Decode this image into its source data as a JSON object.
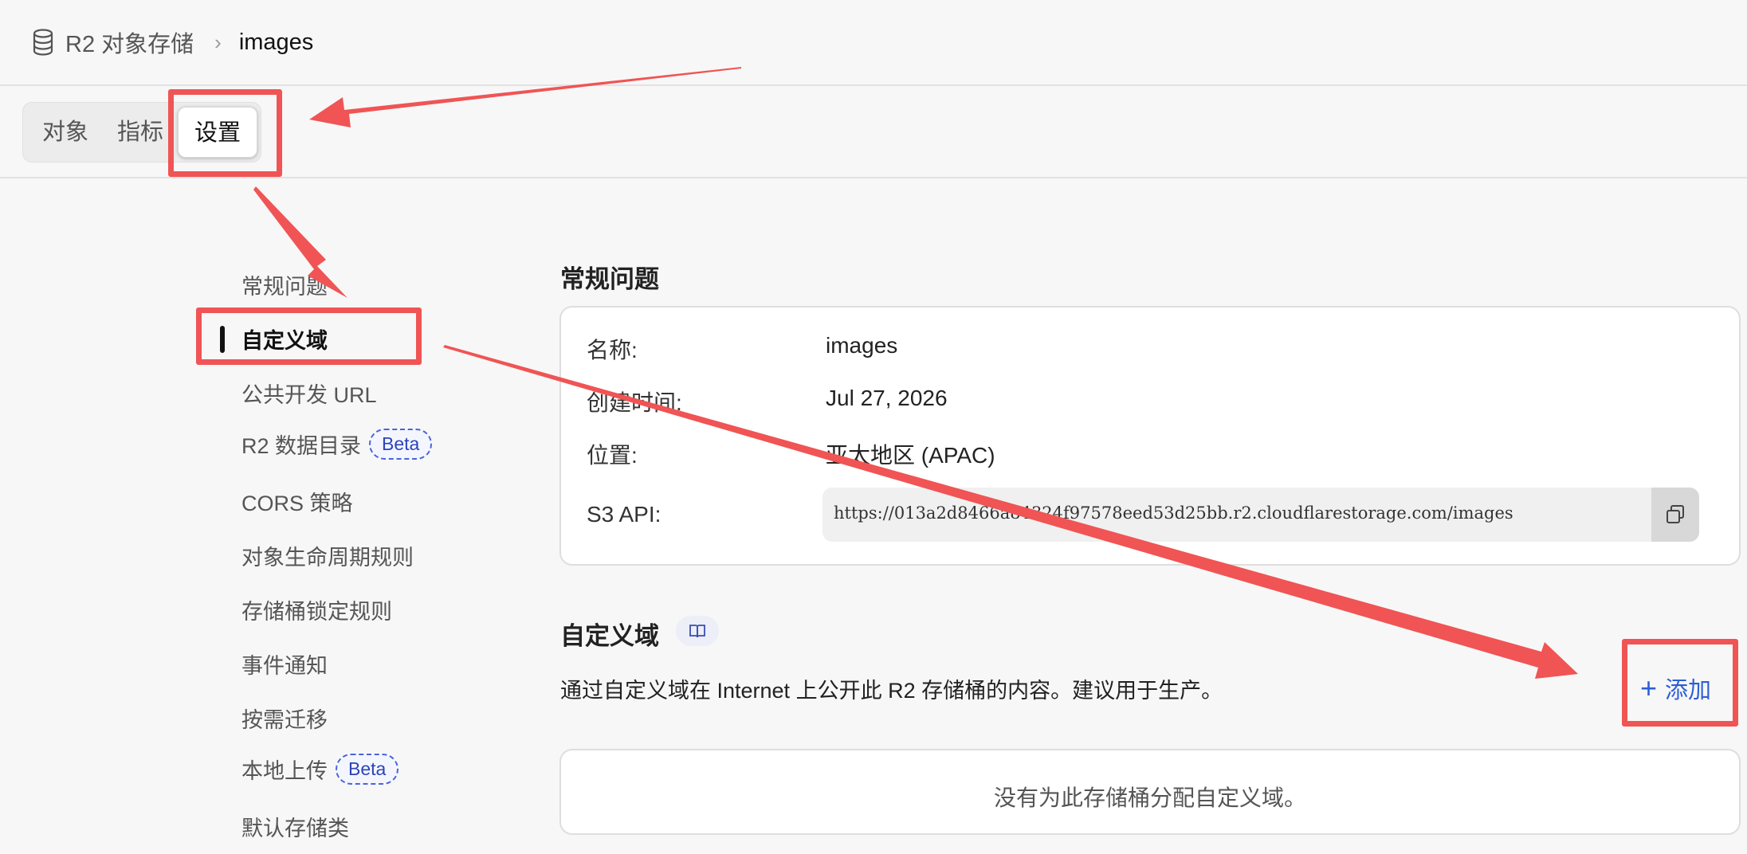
{
  "breadcrumb": {
    "root": "R2 对象存储",
    "separator": "›",
    "current": "images"
  },
  "tabs": [
    {
      "label": "对象",
      "active": false
    },
    {
      "label": "指标",
      "active": false
    },
    {
      "label": "设置",
      "active": true
    }
  ],
  "sidebar": {
    "items": [
      {
        "label": "常规问题"
      },
      {
        "label": "自定义域",
        "active": true
      },
      {
        "label": "公共开发 URL"
      },
      {
        "label": "R2 数据目录",
        "badge": "Beta"
      },
      {
        "label": "CORS 策略"
      },
      {
        "label": "对象生命周期规则"
      },
      {
        "label": "存储桶锁定规则"
      },
      {
        "label": "事件通知"
      },
      {
        "label": "按需迁移"
      },
      {
        "label": "本地上传",
        "badge": "Beta"
      },
      {
        "label": "默认存储类"
      }
    ]
  },
  "general": {
    "title": "常规问题",
    "rows": [
      {
        "label": "名称:",
        "value": "images"
      },
      {
        "label": "创建时间:",
        "value": "Jul 27, 2026"
      },
      {
        "label": "位置:",
        "value": "亚太地区 (APAC)"
      },
      {
        "label": "S3 API:",
        "value": "https://013a2d8466a84324f97578eed53d25bb.r2.cloudflarestorage.com/images"
      }
    ]
  },
  "custom_domain": {
    "title": "自定义域",
    "description": "通过自定义域在 Internet 上公开此 R2 存储桶的内容。建议用于生产。",
    "add_label": "添加",
    "add_icon": "plus-icon",
    "empty_text": "没有为此存储桶分配自定义域。"
  },
  "annotations": {
    "color": "#f05454"
  },
  "icons": {
    "breadcrumb": "database-icon",
    "copy": "copy-icon",
    "docs": "book-icon"
  }
}
